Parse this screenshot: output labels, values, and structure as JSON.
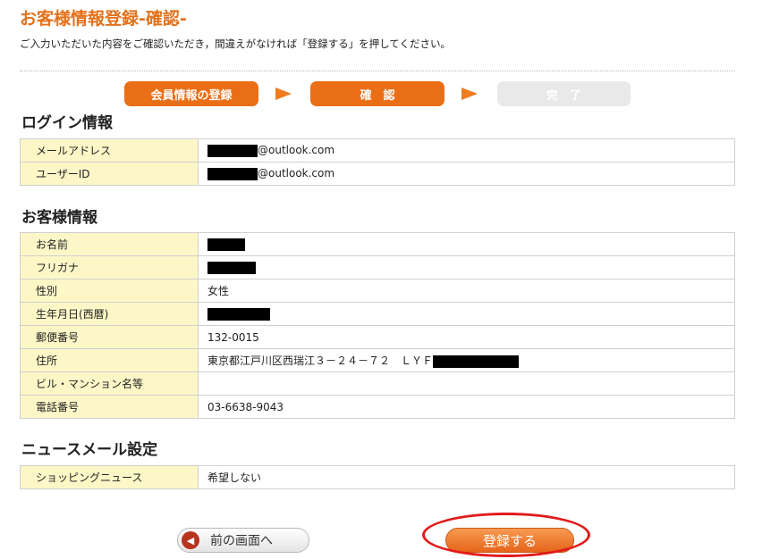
{
  "page": {
    "title": "お客様情報登録-確認-",
    "intro": "ご入力いただいた内容をご確認いただき，間違えがなければ「登録する」を押してください。"
  },
  "steps": [
    {
      "label": "会員情報の登録",
      "state": "active"
    },
    {
      "label": "確　認",
      "state": "active"
    },
    {
      "label": "完　了",
      "state": "inactive"
    }
  ],
  "login_section": {
    "heading": "ログイン情報",
    "rows": [
      {
        "label": "メールアドレス",
        "value": "@outlook.com"
      },
      {
        "label": "ユーザーID",
        "value": "@outlook.com"
      }
    ]
  },
  "customer_section": {
    "heading": "お客様情報",
    "rows": [
      {
        "label": "お名前",
        "value": ""
      },
      {
        "label": "フリガナ",
        "value": ""
      },
      {
        "label": "性別",
        "value": "女性"
      },
      {
        "label": "生年月日(西暦)",
        "value": ""
      },
      {
        "label": "郵便番号",
        "value": "132-0015"
      },
      {
        "label": "住所",
        "value": "東京都江戸川区西瑞江３－２４－７２　ＬＹＦ"
      },
      {
        "label": "ビル・マンション名等",
        "value": ""
      },
      {
        "label": "電話番号",
        "value": "03-6638-9043"
      }
    ]
  },
  "news_section": {
    "heading": "ニュースメール設定",
    "rows": [
      {
        "label": "ショッピングニュース",
        "value": "希望しない"
      }
    ]
  },
  "buttons": {
    "back_label": "前の画面へ",
    "register_label": "登録する"
  },
  "colors": {
    "accent": "#ea6e16",
    "label_bg": "#fdf7c8",
    "highlight": "#e21a1a"
  }
}
